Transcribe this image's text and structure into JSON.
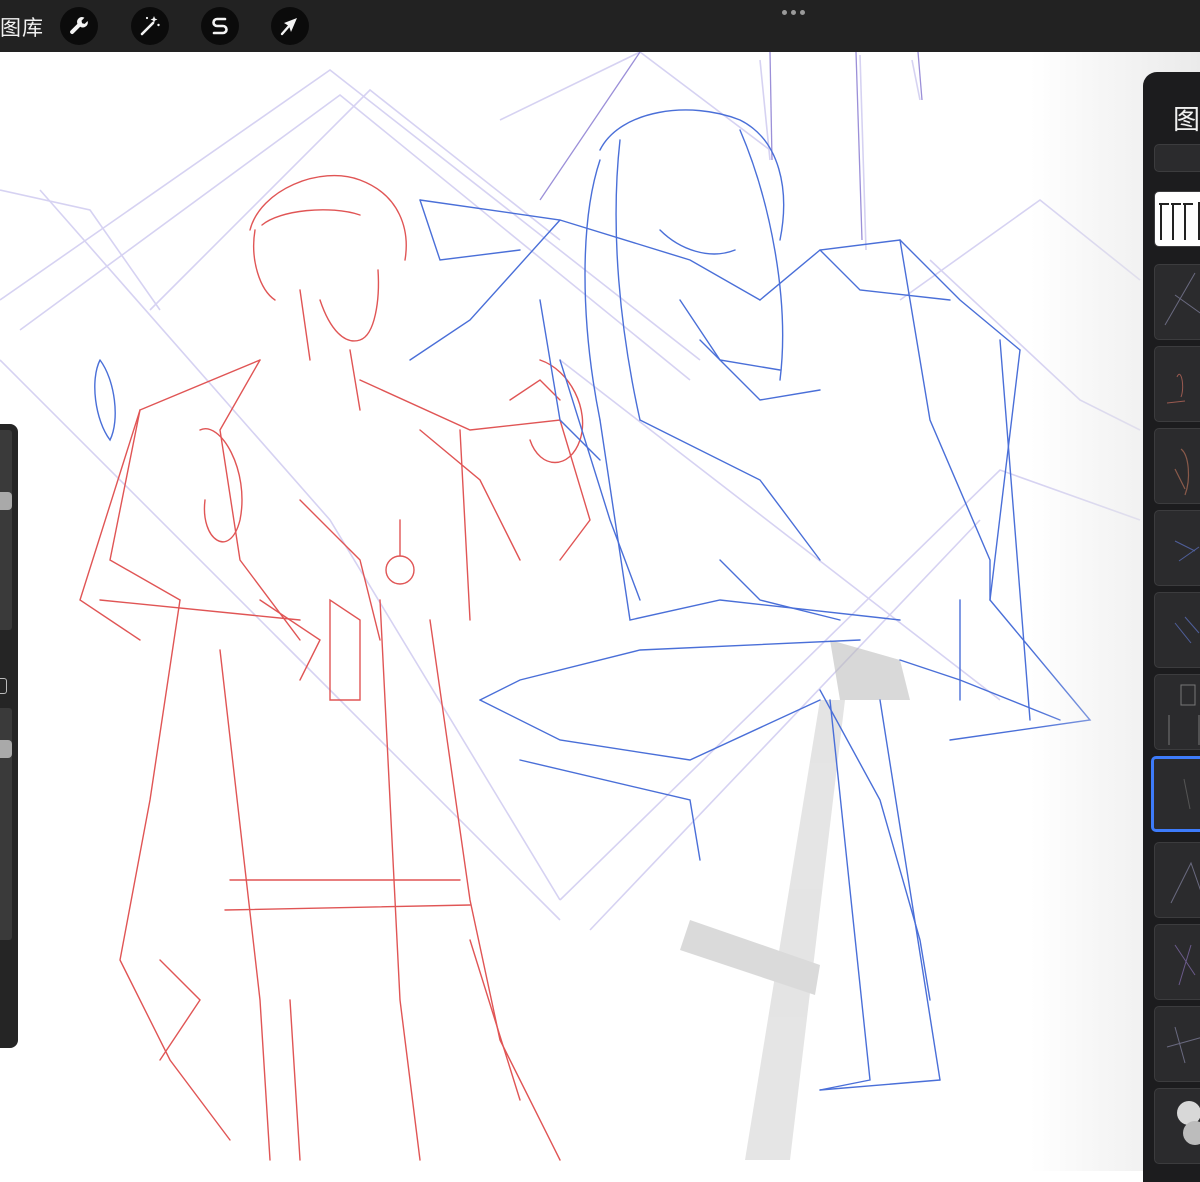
{
  "toolbar": {
    "gallery_label": "图库",
    "tools": [
      {
        "name": "actions",
        "icon": "wrench-icon"
      },
      {
        "name": "adjustments",
        "icon": "magic-wand-icon"
      },
      {
        "name": "selection",
        "icon": "selection-s-icon"
      },
      {
        "name": "transform",
        "icon": "arrow-cursor-icon"
      }
    ],
    "more_icon": "ellipsis-icon"
  },
  "layers_panel": {
    "title": "图层",
    "selected_index": 7,
    "layer_count": 13
  },
  "colors": {
    "toolbar_bg": "#222222",
    "panel_bg": "#1c1c1e",
    "selection_accent": "#3d7bfa",
    "sketch_red": "#e05555",
    "sketch_blue": "#4a6fd8",
    "sketch_lavender": "#c9c5ee"
  }
}
